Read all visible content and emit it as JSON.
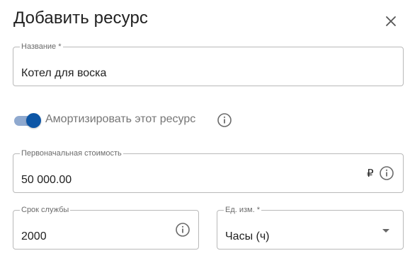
{
  "dialog": {
    "title": "Добавить ресурс"
  },
  "name_field": {
    "label": "Название *",
    "value": "Котел для воска"
  },
  "amortize": {
    "label": "Амортизировать этот ресурс",
    "enabled": true
  },
  "initial_cost": {
    "label": "Первоначальная стоимость",
    "value": "50 000.00",
    "currency": "₽"
  },
  "service_life": {
    "label": "Срок службы",
    "value": "2000"
  },
  "unit": {
    "label": "Ед. изм. *",
    "selected": "Часы (ч)"
  },
  "colors": {
    "accent": "#0d56a6",
    "track": "#8fa9cf",
    "border": "#b9b9b9"
  }
}
